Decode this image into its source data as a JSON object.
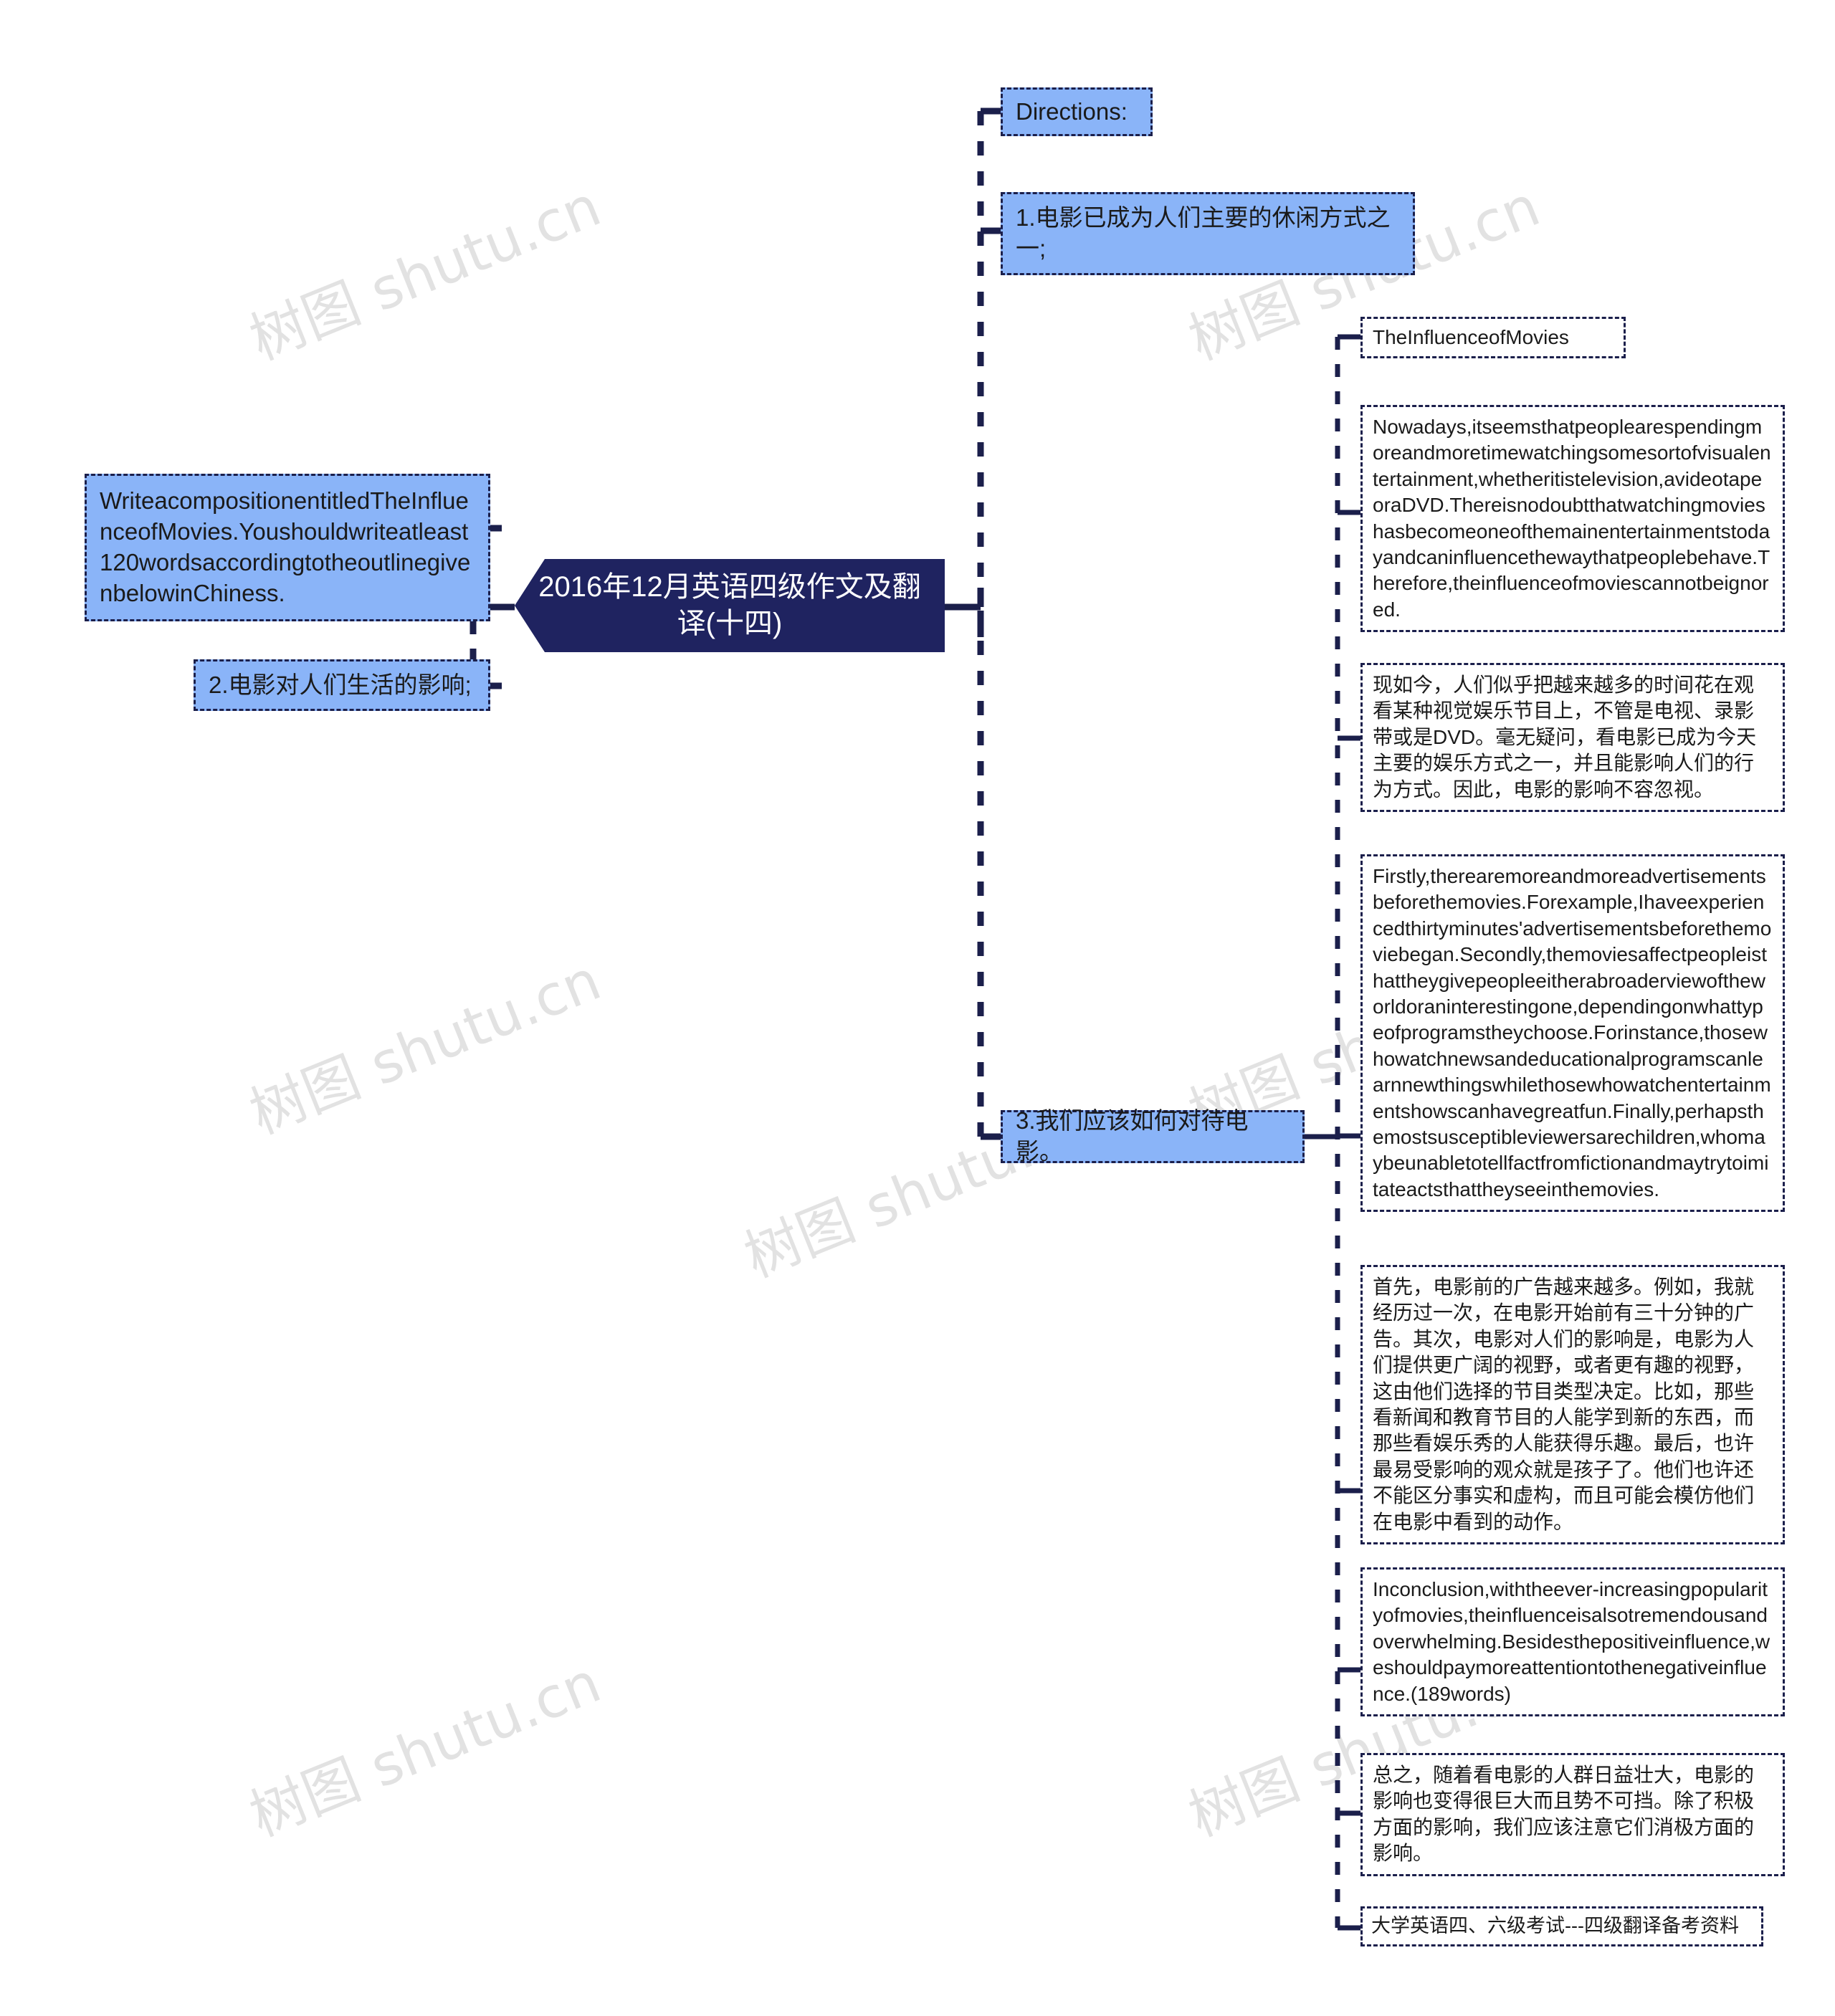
{
  "central": {
    "title": "2016年12月英语四级作文及翻译(十四)"
  },
  "left_branch": {
    "nodes": [
      {
        "id": "compose-prompt",
        "text": "WriteacompositionentitledTheInfluenceofMovies.Youshouldwriteatleast120wordsaccordingtotheoutlinegivenbelowinChiness."
      },
      {
        "id": "outline-point-2",
        "text": "2.电影对人们生活的影响;"
      }
    ]
  },
  "right_branch": {
    "nodes": [
      {
        "id": "directions-label",
        "text": "Directions:"
      },
      {
        "id": "outline-point-1",
        "text": "1.电影已成为人们主要的休闲方式之一;"
      },
      {
        "id": "outline-point-3",
        "text": "3.我们应该如何对待电影。"
      }
    ]
  },
  "essay_branch": {
    "nodes": [
      {
        "id": "essay-title",
        "text": "TheInfluenceofMovies"
      },
      {
        "id": "essay-para-1-en",
        "text": "Nowadays,itseemsthatpeoplearespendingmoreandmoretimewatchingsomesortofvisualentertainment,whetheritistelevision,avideotapeoraDVD.Thereisnodoubtthatwatchingmovieshasbecomeoneofthemainentertainmentstodayandcaninfluencethewaythatpeoplebehave.Therefore,theinfluenceofmoviescannotbeignored."
      },
      {
        "id": "essay-para-1-zh",
        "text": "现如今，人们似乎把越来越多的时间花在观看某种视觉娱乐节目上，不管是电视、录影带或是DVD。毫无疑问，看电影已成为今天主要的娱乐方式之一，并且能影响人们的行为方式。因此，电影的影响不容忽视。"
      },
      {
        "id": "essay-para-2-en",
        "text": "Firstly,therearemoreandmoreadvertisementsbeforethemovies.Forexample,Ihaveexperiencedthirtyminutes'advertisementsbeforethemoviebegan.Secondly,themoviesaffectpeopleisthattheygivepeopleeitherabroaderviewoftheworldoraninterestingone,dependingonwhattypeofprogramstheychoose.Forinstance,thosewhowatchnewsandeducationalprogramscanlearnnewthingswhilethosewhowatchentertainmentshowscanhavegreatfun.Finally,perhapsthemostsusceptibleviewersarechildren,whomaybeunabletotellfactfromfictionandmaytrytoimitateactsthattheyseeinthemovies."
      },
      {
        "id": "essay-para-2-zh",
        "text": "首先，电影前的广告越来越多。例如，我就经历过一次，在电影开始前有三十分钟的广告。其次，电影对人们的影响是，电影为人们提供更广阔的视野，或者更有趣的视野，这由他们选择的节目类型决定。比如，那些看新闻和教育节目的人能学到新的东西，而那些看娱乐秀的人能获得乐趣。最后，也许最易受影响的观众就是孩子了。他们也许还不能区分事实和虚构，而且可能会模仿他们在电影中看到的动作。"
      },
      {
        "id": "essay-para-3-en",
        "text": "Inconclusion,withtheever-increasingpopularityofmovies,theinfluenceisalsotremendousandoverwhelming.Besidesthepositiveinfluence,weshouldpaymoreattentiontothenegativeinfluence.(189words)"
      },
      {
        "id": "essay-para-3-zh",
        "text": "总之，随着看电影的人群日益壮大，电影的影响也变得很巨大而且势不可挡。除了积极方面的影响，我们应该注意它们消极方面的影响。"
      },
      {
        "id": "footer-source",
        "text": "大学英语四、六级考试---四级翻译备考资料"
      }
    ]
  },
  "watermarks": [
    "树图 shutu.cn",
    "树图 shutu.cn",
    "树图 shutu.cn",
    "树图 shutu.cn",
    "树图 shutu.cn",
    "树图 shutu.cn",
    "树图 shutu.cn"
  ],
  "colors": {
    "node_fill_blue": "#8ab4f8",
    "node_fill_white": "#ffffff",
    "node_border": "#1b1f4b",
    "central_fill": "#1f2360",
    "central_text": "#ffffff",
    "body_text": "#1a1a1a",
    "watermark": "#e2e2e2"
  }
}
